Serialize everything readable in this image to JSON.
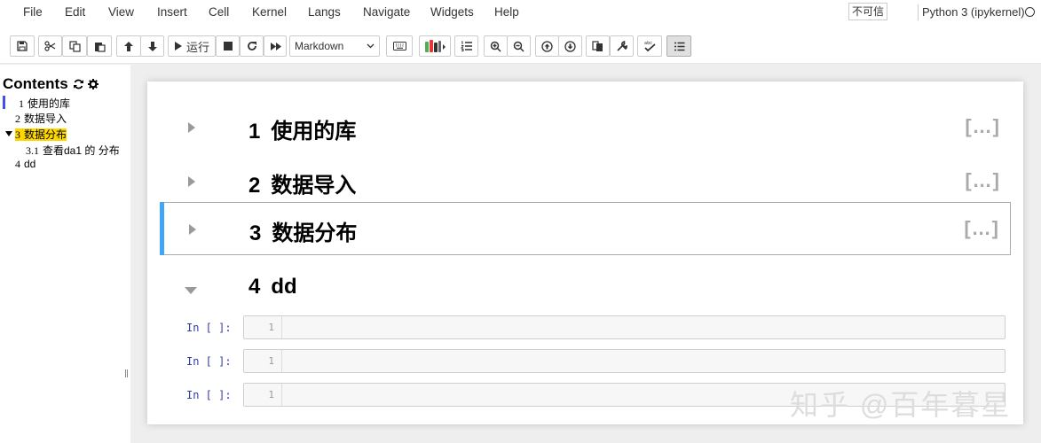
{
  "menubar": {
    "items": [
      "File",
      "Edit",
      "View",
      "Insert",
      "Cell",
      "Kernel",
      "Langs",
      "Navigate",
      "Widgets",
      "Help"
    ],
    "trust_label": "不可信",
    "kernel_name": "Python 3 (ipykernel)"
  },
  "toolbar": {
    "run_label": "运行",
    "cell_type": "Markdown",
    "icons": [
      "save-icon",
      "cut-icon",
      "copy-icon",
      "paste-icon",
      "move-up-icon",
      "move-down-icon",
      "run-icon",
      "stop-icon",
      "restart-icon",
      "fast-forward-icon",
      "keyboard-icon",
      "nbextension-icon",
      "numbered-list-icon",
      "zoom-in-icon",
      "zoom-out-icon",
      "move-cell-up-icon",
      "move-cell-down-icon",
      "hide-code-icon",
      "wrench-icon",
      "spellcheck-icon",
      "toc-toggle-icon"
    ]
  },
  "toc": {
    "title": "Contents",
    "items": [
      {
        "num": "1",
        "label": "使用的库"
      },
      {
        "num": "2",
        "label": "数据导入"
      },
      {
        "num": "3",
        "label": "数据分布"
      },
      {
        "num": "3.1",
        "label": "查看da1 的 分布"
      },
      {
        "num": "4",
        "label": "dd"
      }
    ],
    "active_color": "#ffd700",
    "marker_color": "#3f51e8"
  },
  "notebook": {
    "headings": [
      {
        "num": "1",
        "title": "使用的库",
        "collapsed_marker": "[…]"
      },
      {
        "num": "2",
        "title": "数据导入",
        "collapsed_marker": "[…]"
      },
      {
        "num": "3",
        "title": "数据分布",
        "collapsed_marker": "[…]"
      },
      {
        "num": "4",
        "title": "dd"
      }
    ],
    "code_cells": [
      {
        "prompt": "In [ ]:",
        "line_number": "1"
      },
      {
        "prompt": "In [ ]:",
        "line_number": "1"
      },
      {
        "prompt": "In [ ]:",
        "line_number": "1"
      }
    ],
    "selected_color": "#42a5f5"
  },
  "watermark": "知乎 @百年暮星"
}
